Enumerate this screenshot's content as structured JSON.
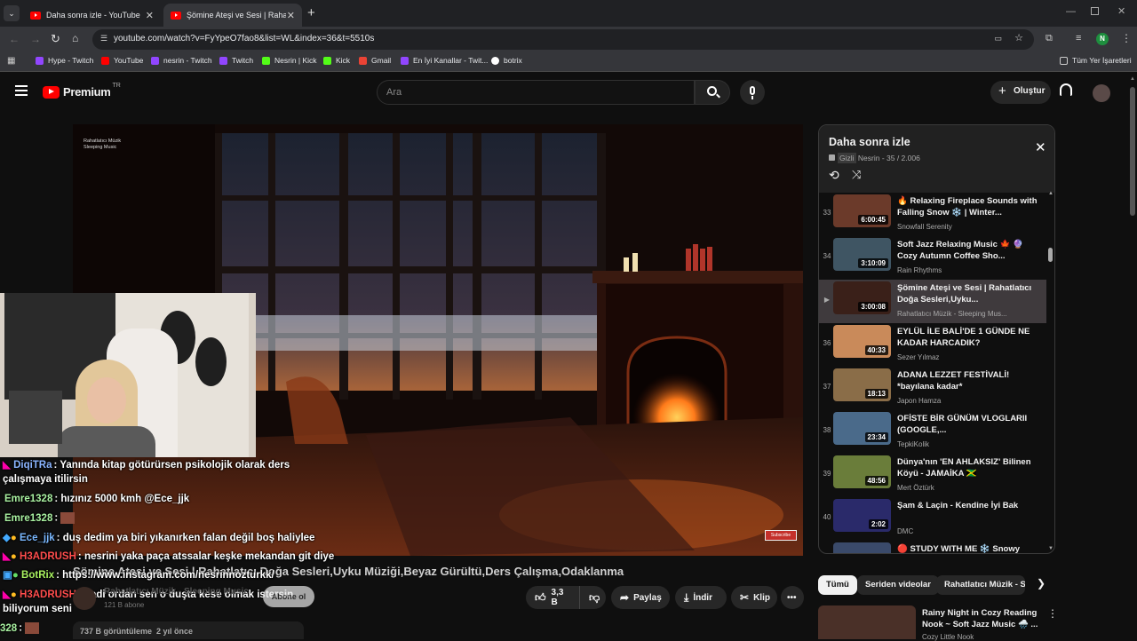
{
  "browser": {
    "tabs": [
      {
        "title": "Daha sonra izle - YouTube"
      },
      {
        "title": "Şömine Ateşi ve Sesi | Rahatlat"
      }
    ],
    "url": "youtube.com/watch?v=FyYpeO7fao8&list=WL&index=36&t=5510s",
    "profile_initial": "N",
    "bookmarks": [
      {
        "label": "Hype - Twitch",
        "color": "#9146ff"
      },
      {
        "label": "YouTube",
        "color": "#ff0000"
      },
      {
        "label": "nesrin - Twitch",
        "color": "#9146ff"
      },
      {
        "label": "Twitch",
        "color": "#9146ff"
      },
      {
        "label": "Nesrin | Kick",
        "color": "#53fc18"
      },
      {
        "label": "Kick",
        "color": "#53fc18"
      },
      {
        "label": "Gmail",
        "color": "#ea4335"
      },
      {
        "label": "En İyi Kanallar - Twit...",
        "color": "#9146ff"
      },
      {
        "label": "botrix",
        "color": "#ffffff"
      }
    ],
    "all_bookmarks": "Tüm Yer İşaretleri"
  },
  "header": {
    "logo": "Premium",
    "region": "TR",
    "search_placeholder": "Ara",
    "create": "Oluştur"
  },
  "video": {
    "overlay_brand_line1": "Rahatlatıcı Müzik",
    "overlay_brand_line2": "Sleeping Music",
    "subscribe_overlay": "Subscribe",
    "title": "Şömine Ateşi ve Sesi | Rahatlatıcı Doğa Sesleri,Uyku Müziği,Beyaz Gürültü,Ders Çalışma,Odaklanma",
    "channel": "Rahatlatıcı Müzik - Sleeping Music",
    "subscribers": "121 B abone",
    "subscribe_btn": "Abone ol",
    "likes": "3,3 B",
    "share": "Paylaş",
    "download": "İndir",
    "clip": "Klip",
    "views": "737 B görüntüleme  2 yıl önce"
  },
  "chat": [
    {
      "user": "DiqiTRa",
      "user_color": "#8ab4ff",
      "text": ": Yanında kitap götürürsen psikolojik olarak ders"
    },
    {
      "user": "",
      "user_color": "#fff",
      "text": "çalışmaya itilirsin"
    },
    {
      "user": "Emre1328",
      "user_color": "#a8f0a0",
      "text": ": hızınız 5000 kmh @Ece_jjk"
    },
    {
      "user": "Emre1328",
      "user_color": "#a8f0a0",
      "text": ":"
    },
    {
      "user": "Ece_jjk",
      "user_color": "#7ab8ff",
      "text": ": duş dedim ya biri yıkanırken falan değil boş haliylee"
    },
    {
      "user": "H3ADRUSH",
      "user_color": "#ff4d4d",
      "text": ": nesrini yaka paça atssalar keşke mekandan git diye"
    },
    {
      "user": "BotRix",
      "user_color": "#a8f060",
      "text": ": https://www.instagram.com/nesrinnozturkk/"
    },
    {
      "user": "H3ADRUSH",
      "user_color": "#ff4d4d",
      "text": ": hadi ordan sen o duşta kese olmak istersin"
    },
    {
      "user": "",
      "user_color": "#fff",
      "text": "biliyorum seni"
    },
    {
      "user": "328",
      "user_color": "#a8f0a0",
      "text": ":"
    }
  ],
  "playlist": {
    "title": "Daha sonra izle",
    "privacy": "Gizli",
    "meta": "Nesrin - 35 / 2.006",
    "items": [
      {
        "index": "33",
        "title": "🔥 Relaxing Fireplace Sounds with Falling Snow ❄️ | Winter...",
        "channel": "Snowfall Serenity",
        "duration": "6:00:45",
        "color": "#6b3a2a"
      },
      {
        "index": "34",
        "title": "Soft Jazz Relaxing Music 🍁 🔮 Cozy Autumn Coffee Sho...",
        "channel": "Rain Rhythms",
        "duration": "3:10:09",
        "color": "#3f5563"
      },
      {
        "index": "▶",
        "title": "Şömine Ateşi ve Sesi | Rahatlatıcı Doğa Sesleri,Uyku...",
        "channel": "Rahatlatıcı Müzik - Sleeping Mus...",
        "duration": "3:00:08",
        "color": "#3a2019"
      },
      {
        "index": "36",
        "title": "EYLÜL İLE BALİ'DE 1 GÜNDE NE KADAR HARCADIK?",
        "channel": "Sezer Yılmaz",
        "duration": "40:33",
        "color": "#c98a5a"
      },
      {
        "index": "37",
        "title": "ADANA LEZZET FESTİVALİ! *bayılana kadar*",
        "channel": "Japon Hamza",
        "duration": "18:13",
        "color": "#8a6d48"
      },
      {
        "index": "38",
        "title": "OFİSTE BİR GÜNÜM VLOGLARII (GOOGLE,...",
        "channel": "TepkiKolik",
        "duration": "23:34",
        "color": "#4a6a8a"
      },
      {
        "index": "39",
        "title": "Dünya'nın 'EN AHLAKSIZ' Bilinen Köyü - JAMAİKA 🇯🇲",
        "channel": "Mert Öztürk",
        "duration": "48:56",
        "color": "#6a7d3a"
      },
      {
        "index": "40",
        "title": "Şam & Laçin - Kendine İyi Bak",
        "channel": "DMC",
        "duration": "2:02",
        "color": "#2a2a6a"
      },
      {
        "index": "41",
        "title": "🔴 STUDY WITH ME ❄️ Snowy Edition | Cozy Fireplace...",
        "channel": "",
        "duration": "",
        "color": "#3a4a6a"
      }
    ]
  },
  "chips": [
    "Tümü",
    "Seriden videolar",
    "Rahatlatıcı Müzik - Sl"
  ],
  "recommended": {
    "title": "Rainy Night in Cozy Reading Nook ~ Soft Jazz Music 🌧️ ...",
    "channel": "Cozy Little Nook"
  }
}
